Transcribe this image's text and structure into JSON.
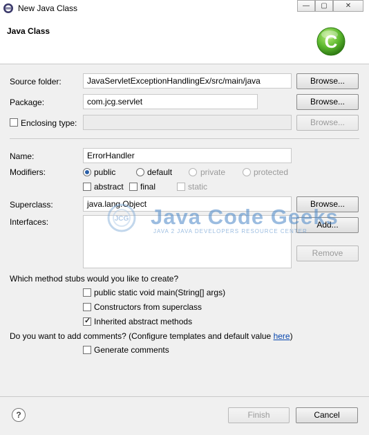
{
  "window": {
    "title": "New Java Class",
    "minimize_glyph": "—",
    "maximize_glyph": "▢",
    "close_glyph": "✕"
  },
  "header": {
    "title": "Java Class",
    "logo_letter": "C"
  },
  "form": {
    "source_folder_label": "Source folder:",
    "source_folder_value": "JavaServletExceptionHandlingEx/src/main/java",
    "package_label": "Package:",
    "package_value": "com.jcg.servlet",
    "enclosing_type_label": "Enclosing type:",
    "enclosing_type_value": "",
    "browse_label": "Browse...",
    "name_label": "Name:",
    "name_value": "ErrorHandler",
    "modifiers_label": "Modifiers:",
    "modifiers": {
      "public": "public",
      "default": "default",
      "private": "private",
      "protected": "protected",
      "abstract": "abstract",
      "final": "final",
      "static": "static"
    },
    "superclass_label": "Superclass:",
    "superclass_value": "java.lang.Object",
    "interfaces_label": "Interfaces:",
    "add_label": "Add...",
    "remove_label": "Remove",
    "stubs_question": "Which method stubs would you like to create?",
    "stub_main": "public static void main(String[] args)",
    "stub_constructors": "Constructors from superclass",
    "stub_inherited": "Inherited abstract methods",
    "comments_question": "Do you want to add comments? (Configure templates and default value",
    "comments_link": "here",
    "comments_close": ")",
    "generate_comments": "Generate comments"
  },
  "watermark": {
    "brand": "Java Code Geeks",
    "tagline": "JAVA 2 JAVA DEVELOPERS RESOURCE CENTER",
    "logo_text": "JCG"
  },
  "footer": {
    "help_glyph": "?",
    "finish_label": "Finish",
    "cancel_label": "Cancel"
  },
  "colors": {
    "logo_green": "#5cb82e",
    "radio_selected": "#2a5fa8",
    "watermark_blue": "#4a87c8"
  }
}
